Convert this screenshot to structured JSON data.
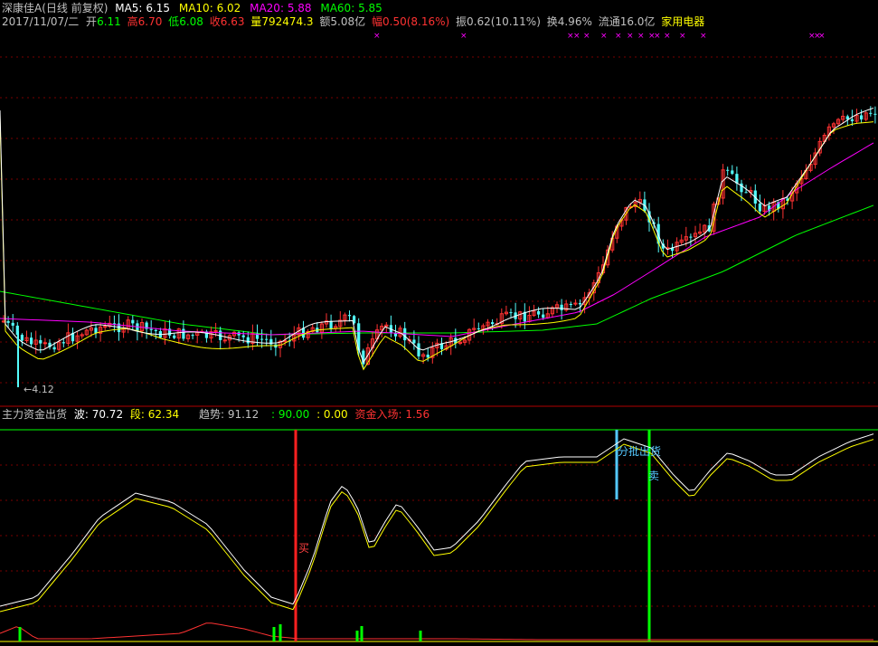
{
  "header": {
    "stock_name": "深康佳A",
    "chart_mode": "(日线 前复权)",
    "ma5_label": "MA5:",
    "ma5_value": "6.15",
    "ma10_label": "MA10:",
    "ma10_value": "6.02",
    "ma20_label": "MA20:",
    "ma20_value": "5.88",
    "ma60_label": "MA60:",
    "ma60_value": "5.85"
  },
  "quote": {
    "date": "2017/11/07/二",
    "open_label": "开",
    "open": "6.11",
    "high_label": "高",
    "high": "6.70",
    "low_label": "低",
    "low": "6.08",
    "close_label": "收",
    "close": "6.63",
    "volume_label": "量",
    "volume": "792474.3",
    "amount_label": "额",
    "amount": "5.08亿",
    "change_label": "幅",
    "change": "0.50",
    "change_pct": "(8.16%)",
    "amplitude_label": "振",
    "amplitude": "0.62",
    "amplitude_pct": "(10.11%)",
    "turnover_label": "换",
    "turnover": "4.96%",
    "float_label": "流通",
    "float": "16.0亿",
    "industry": "家用电器"
  },
  "price_panel": {
    "low_marker": "4.12",
    "event_marker": "×"
  },
  "indicator": {
    "name": "主力资金出货",
    "wave_label": "波:",
    "wave_value": "70.72",
    "segment_label": "段:",
    "segment_value": "62.34",
    "trend_label": "趋势:",
    "trend_value": "91.12",
    "level1": ": 90.00",
    "level2": ": 0.00",
    "inflow_label": "资金入场:",
    "inflow_value": "1.56",
    "buy_label": "买",
    "sell_batch_label": "分批出货",
    "sell_label": "卖"
  },
  "colors": {
    "background": "#000000",
    "text_white": "#c0c0c0",
    "ma5": "#ffffff",
    "ma10": "#ffff00",
    "ma20": "#ff00ff",
    "ma60": "#00ff00",
    "up": "#ff3232",
    "down": "#54fcfc",
    "grid": "#780000"
  }
}
